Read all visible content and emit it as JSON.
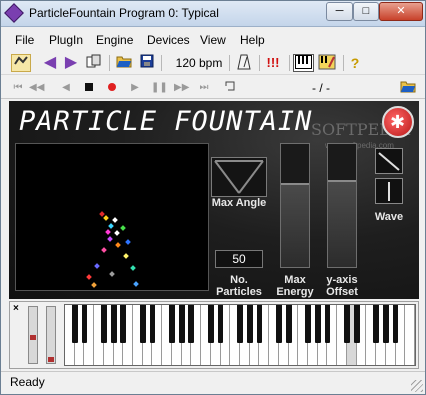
{
  "window": {
    "title": "ParticleFountain Program 0: Typical",
    "min_glyph": "─",
    "max_glyph": "□",
    "close_glyph": "✕"
  },
  "menu": [
    "File",
    "PlugIn",
    "Engine",
    "Devices",
    "View",
    "Help"
  ],
  "toolbar": {
    "bpm": "120 bpm",
    "alert": "!!!",
    "help": "?",
    "position": "- / -"
  },
  "transport_icons": [
    "skip-back-icon",
    "step-back-icon",
    "rewind-icon",
    "stop-icon",
    "record-icon",
    "play-icon",
    "pause-icon",
    "fast-forward-icon",
    "skip-forward-icon"
  ],
  "plugin": {
    "title": "PARTICLE FOUNTAIN",
    "watermark": "SOFTPEDIA",
    "watermark_url": "www.softpedia.com",
    "max_angle_label": "Max Angle",
    "particles_value": "50",
    "particles_label_1": "No.",
    "particles_label_2": "Particles",
    "energy_label_1": "Max",
    "energy_label_2": "Energy",
    "offset_label_1": "y-axis",
    "offset_label_2": "Offset",
    "wave_label": "Wave",
    "max_energy_level": 0.68,
    "y_offset_level": 0.71
  },
  "keyboard": {
    "close_glyph": "×",
    "white_keys": 36
  },
  "status": {
    "text": "Ready"
  },
  "colors": {
    "record": "#e02020",
    "accent_purple": "#7a3fb0",
    "alert_red": "#d01010"
  }
}
